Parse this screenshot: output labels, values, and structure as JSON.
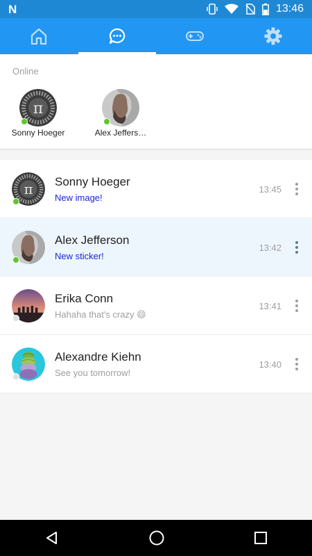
{
  "status_bar": {
    "time": "13:46",
    "icons": [
      "notification-n-icon",
      "vibrate-icon",
      "wifi-icon",
      "no-sim-icon",
      "battery-icon"
    ]
  },
  "tabs": [
    {
      "icon": "home-icon",
      "active": false
    },
    {
      "icon": "chat-icon",
      "active": true
    },
    {
      "icon": "gamepad-icon",
      "active": false
    },
    {
      "icon": "gear-icon",
      "active": false
    }
  ],
  "online": {
    "title": "Online",
    "users": [
      {
        "name": "Sonny Hoeger",
        "avatar": "pi-avatar"
      },
      {
        "name": "Alex Jeffers…",
        "avatar": "man-profile-avatar"
      }
    ]
  },
  "chats": [
    {
      "name": "Sonny Hoeger",
      "message": "New image!",
      "time": "13:45",
      "online": true,
      "unread": true
    },
    {
      "name": "Alex Jefferson",
      "message": "New sticker!",
      "time": "13:42",
      "online": true,
      "unread": true
    },
    {
      "name": "Erika Conn",
      "message": "Hahaha that's crazy 😄",
      "time": "13:41",
      "online": false,
      "unread": false
    },
    {
      "name": "Alexandre Kiehn",
      "message": "See you tomorrow!",
      "time": "13:40",
      "online": false,
      "unread": false
    }
  ],
  "colors": {
    "primary": "#2196f3",
    "status_bar": "#1e88d5",
    "online": "#62c331",
    "unread_text": "#1a25d6",
    "highlight": "#eef6fd"
  },
  "nav_bar": {
    "icons": [
      "back-icon",
      "home-circle-icon",
      "recents-icon"
    ]
  }
}
